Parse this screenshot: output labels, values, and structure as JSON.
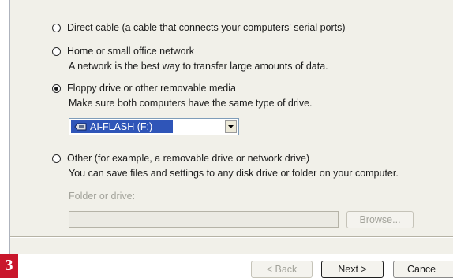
{
  "options": [
    {
      "label": "Direct cable (a cable that connects your computers' serial ports)",
      "description": "",
      "checked": false
    },
    {
      "label": "Home or small office network",
      "description": "A network is the best way to transfer large amounts of data.",
      "checked": false
    },
    {
      "label": "Floppy drive or other removable media",
      "description": "Make sure both computers have the same type of drive.",
      "checked": true
    },
    {
      "label": "Other (for example, a removable drive or network drive)",
      "description": "You can save files and settings to any disk drive or folder on your computer.",
      "checked": false
    }
  ],
  "drive_select": {
    "selected": "AI-FLASH (F:)",
    "icon": "removable-drive-icon"
  },
  "folder": {
    "label": "Folder or drive:",
    "value": "",
    "browse_label": "Browse..."
  },
  "footer": {
    "back_label": "< Back",
    "next_label": "Next >",
    "cancel_label": "Cance"
  },
  "step_badge": "3",
  "colors": {
    "dialog_bg": "#f1f0e9",
    "selection": "#2f55b8",
    "badge": "#c9162b",
    "disabled_text": "#a3a39b"
  }
}
